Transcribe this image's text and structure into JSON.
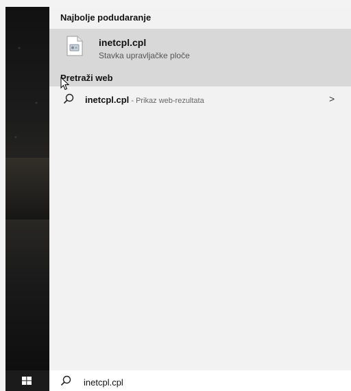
{
  "best_match": {
    "header": "Najbolje podudaranje",
    "title": "inetcpl.cpl",
    "subtitle": "Stavka upravljačke ploče",
    "icon": "control-panel-file-icon"
  },
  "web_search": {
    "header": "Pretraži web",
    "result_title": "inetcpl.cpl",
    "result_suffix": " - Prikaz web-rezultata",
    "chevron": ">",
    "icon": "search-icon"
  },
  "taskbar": {
    "start_icon": "windows-icon",
    "search_icon": "search-icon",
    "search_value": "inetcpl.cpl"
  }
}
